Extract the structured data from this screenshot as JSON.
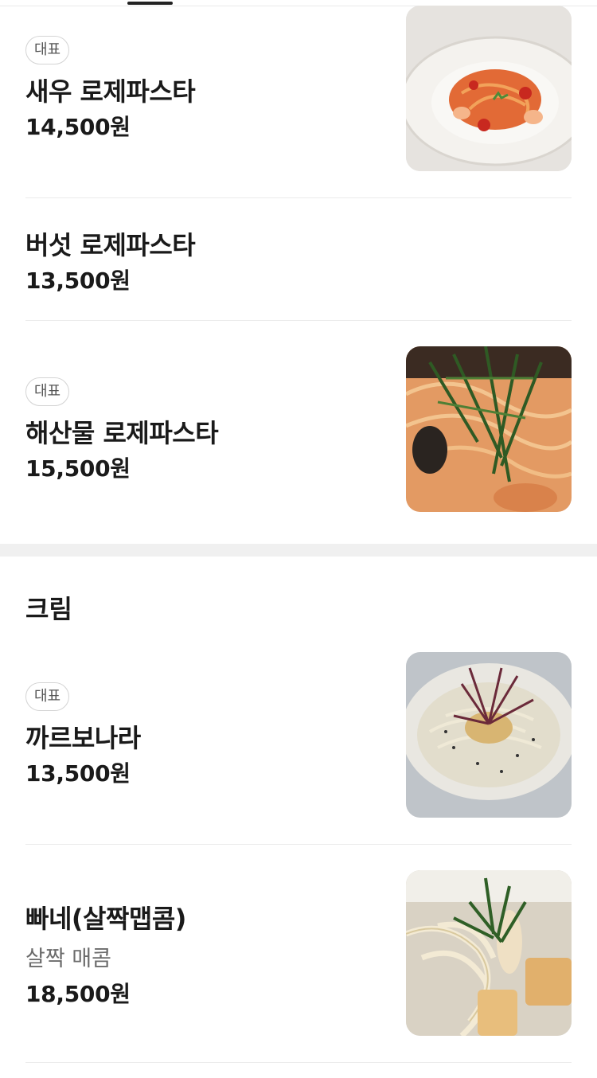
{
  "menu": {
    "badge_label": "대표",
    "items_top": [
      {
        "name": "새우 로제파스타",
        "price": "14,500원",
        "badge": "대표",
        "image": "shrimp-rose-pasta-photo"
      },
      {
        "name": "버섯 로제파스타",
        "price": "13,500원"
      },
      {
        "name": "해산물 로제파스타",
        "price": "15,500원",
        "badge": "대표",
        "image": "seafood-rose-pasta-photo"
      }
    ],
    "cream_section": {
      "title": "크림",
      "items": [
        {
          "name": "까르보나라",
          "price": "13,500원",
          "badge": "대표",
          "image": "carbonara-photo"
        },
        {
          "name": "빠네(살짝맵콤)",
          "description": "살짝 매콤",
          "price": "18,500원",
          "image": "panne-photo"
        }
      ]
    }
  },
  "colors": {
    "text": "#1a1a1a",
    "muted": "#6b6b6b",
    "divider": "#ebebeb",
    "section_gap": "#f0f0f0"
  }
}
